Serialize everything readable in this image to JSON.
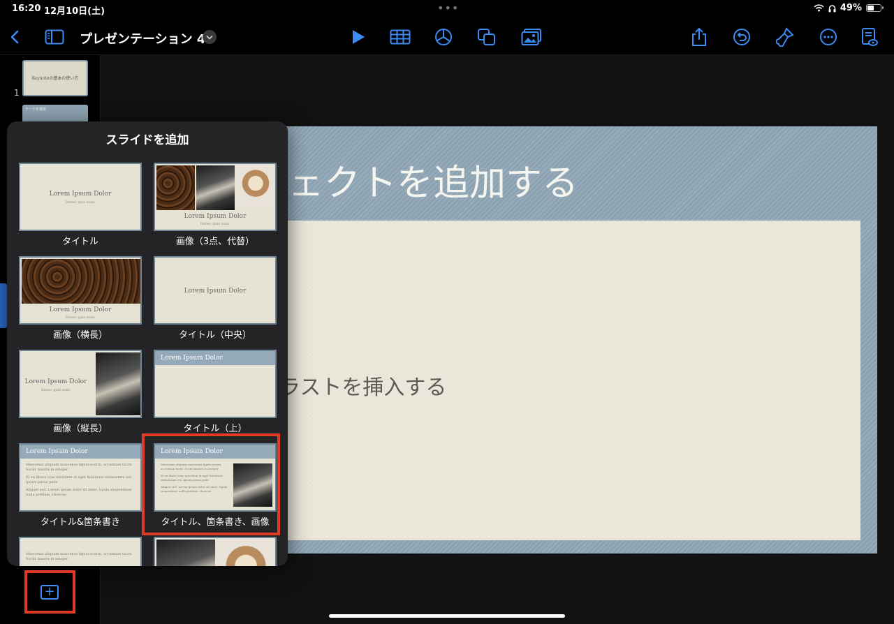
{
  "status_bar": {
    "time": "16:20",
    "date": "12月10日(土)",
    "multitask_dots": "•••",
    "battery": "49%"
  },
  "toolbar": {
    "document_title": "プレゼンテーション 4"
  },
  "navigator": {
    "slide1_thumb_title": "Keynoteの基本の使い方",
    "slide1_number": "1",
    "slide2_thumb_title": "テーマを選択"
  },
  "slide": {
    "title": "ェクトを追加する",
    "body": "ラストを挿入する"
  },
  "popover": {
    "title": "スライドを追加",
    "layouts": [
      {
        "name": "タイトル",
        "caption": "Lorem Ipsum Dolor",
        "subcaption": "Donec quis nunc"
      },
      {
        "name": "画像（3点、代替）",
        "caption": "Lorem Ipsum Dolor",
        "subcaption": "Donec quis nunc"
      },
      {
        "name": "画像（横長）",
        "caption": "Lorem Ipsum Dolor",
        "subcaption": "Donec quis nunc"
      },
      {
        "name": "タイトル（中央）",
        "caption": "Lorem Ipsum Dolor"
      },
      {
        "name": "画像（縦長）",
        "caption": "Lorem Ipsum Dolor",
        "subcaption": "Donec quis nunc"
      },
      {
        "name": "タイトル（上）",
        "caption": "Lorem Ipsum Dolor"
      },
      {
        "name": "タイトル&箇条書き",
        "caption": "Lorem Ipsum Dolor",
        "bullets": [
          "Maecenas aliquam maecenas ligula nostra, accumsan taciti.",
          "Sociis mauris in integer",
          "El eu libero cras interdum at eget habitasse elementum est,",
          "ipsum purus pede",
          "Aliquet sed. Lorem ipsum dolor sit amet, ligula suspendisse",
          "nulla pretium, rhoncus"
        ]
      },
      {
        "name": "タイトル、箇条書き、画像",
        "caption": "Lorem Ipsum Dolor",
        "bullets": [
          "Maecenas aliquam maecenas ligula nostra,",
          "accumsan taciti. Sociis mauris in integer",
          "El eu libero cras interdum at eget habitasse",
          "elementum est, ipsum purus pede",
          "Aliquet sed. Lorem ipsum dolor sit amet, ligula",
          "suspendisse nulla pretium, rhoncus"
        ]
      },
      {
        "name": "",
        "bullets": [
          "Maecenas aliquam maecenas ligula nostra, accumsan taciti.",
          "Sociis mauris in integer"
        ]
      },
      {
        "name": ""
      }
    ]
  },
  "add_slide_button": {
    "symbol": "+"
  }
}
